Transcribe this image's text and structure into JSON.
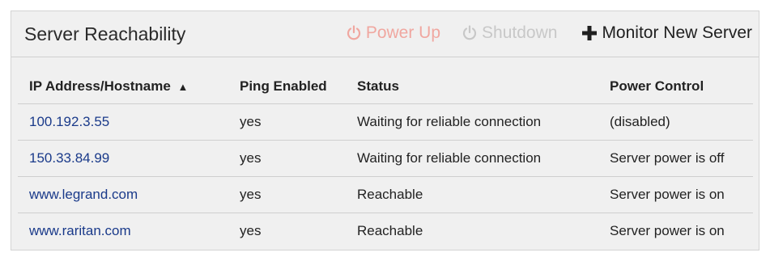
{
  "header": {
    "title": "Server Reachability",
    "actions": {
      "power_up": "Power Up",
      "shutdown": "Shutdown",
      "monitor": "Monitor New Server"
    }
  },
  "table": {
    "columns": {
      "host": "IP Address/Hostname",
      "sort_indicator": "▲",
      "ping": "Ping Enabled",
      "status": "Status",
      "power": "Power Control"
    },
    "rows": [
      {
        "host": "100.192.3.55",
        "ping": "yes",
        "status": "Waiting for reliable connection",
        "power": "(disabled)"
      },
      {
        "host": "150.33.84.99",
        "ping": "yes",
        "status": "Waiting for reliable connection",
        "power": "Server power is off"
      },
      {
        "host": "www.legrand.com",
        "ping": "yes",
        "status": "Reachable",
        "power": "Server power is on"
      },
      {
        "host": "www.raritan.com",
        "ping": "yes",
        "status": "Reachable",
        "power": "Server power is on"
      }
    ]
  },
  "colors": {
    "link": "#1a3a8a",
    "power_up_disabled": "#f0a7a0",
    "shutdown_disabled": "#c8c8c8"
  },
  "icons": {
    "power_up": "power-icon",
    "shutdown": "power-icon",
    "monitor": "plus-icon"
  }
}
